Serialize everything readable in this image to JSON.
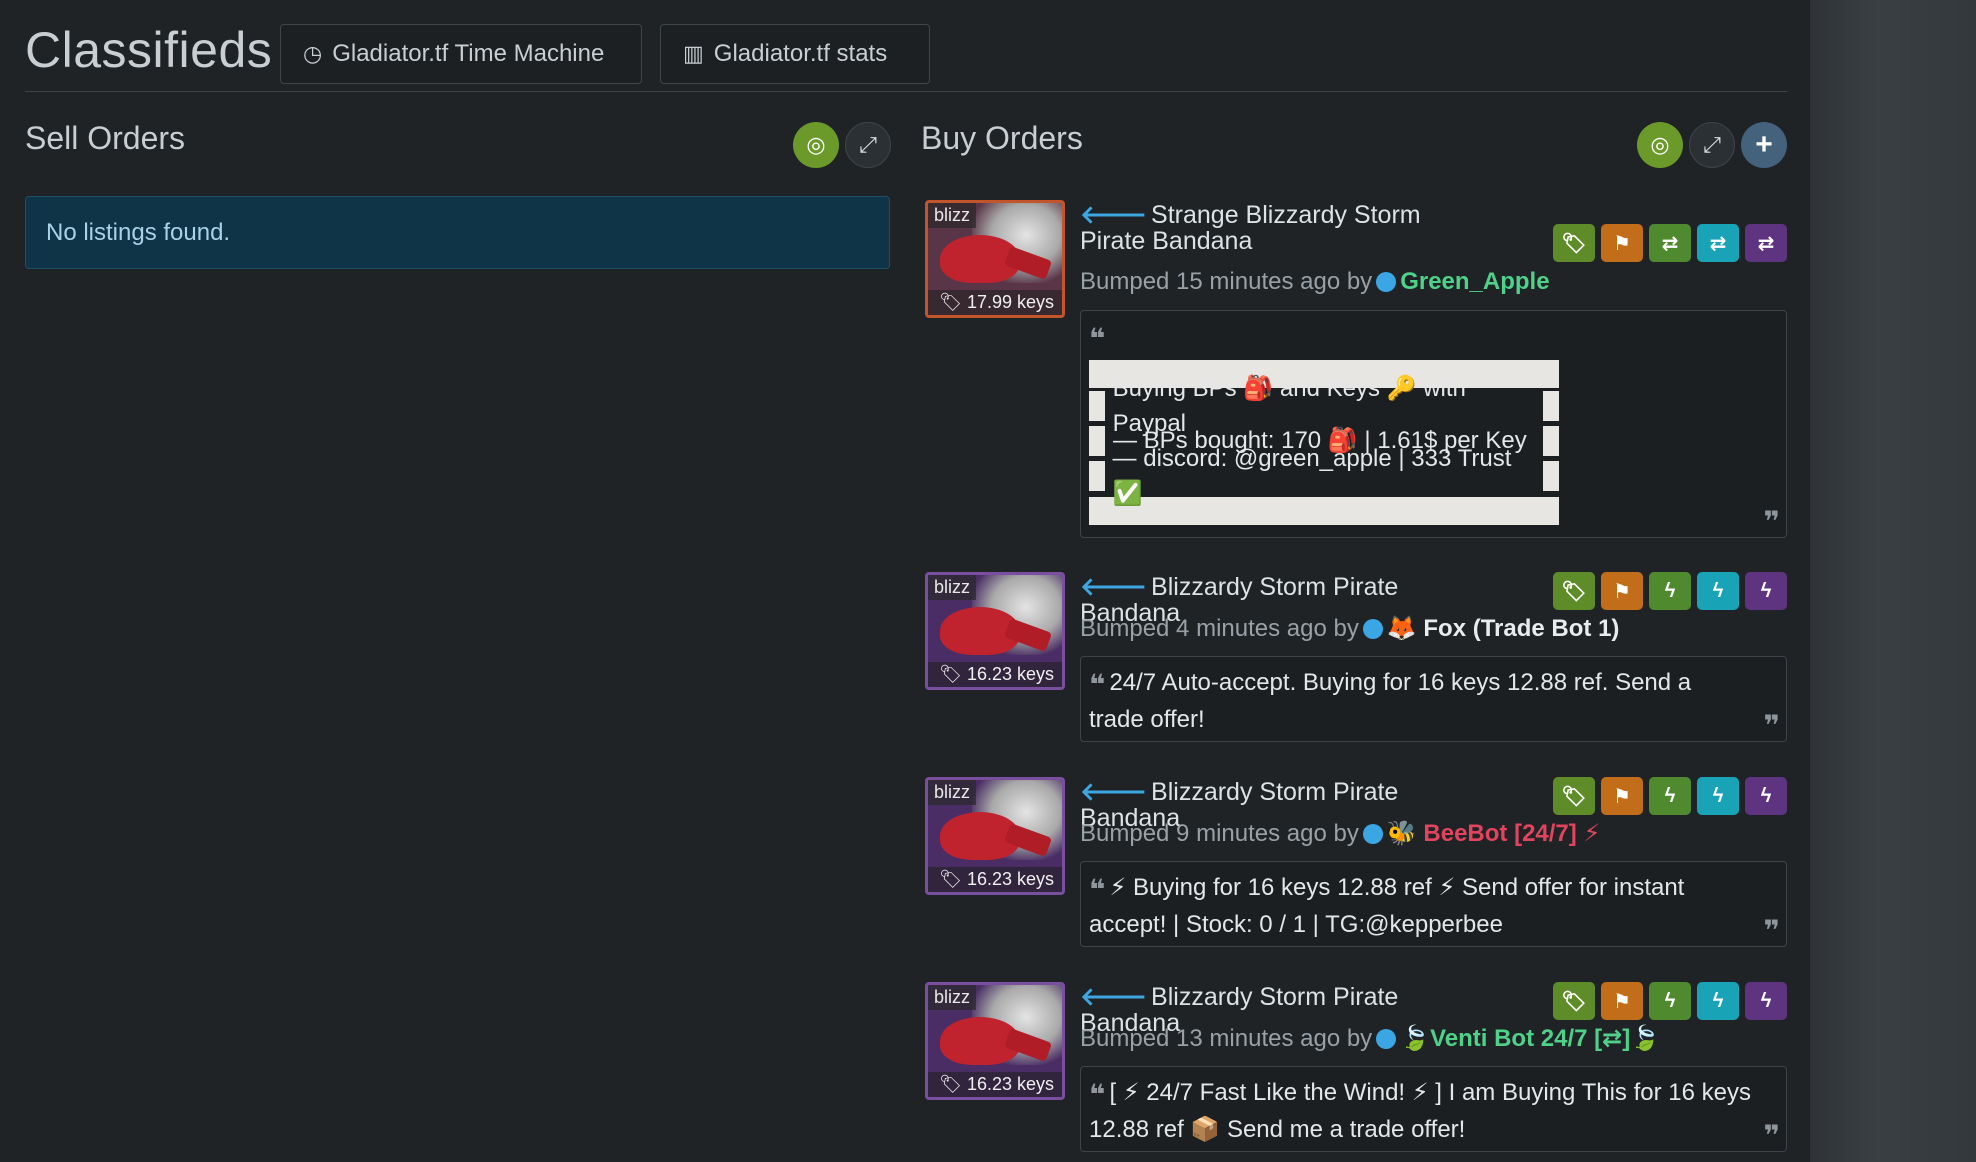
{
  "header": {
    "title": "Classifieds",
    "time_machine": "Gladiator.tf Time Machine",
    "stats": "Gladiator.tf stats"
  },
  "sell": {
    "title": "Sell Orders",
    "empty": "No listings found."
  },
  "buy": {
    "title": "Buy Orders"
  },
  "listings": [
    {
      "thumb_label": "blizz",
      "price": "17.99 keys",
      "name": "Strange Blizzardy Storm Pirate Bandana",
      "bumped": "Bumped 15 minutes ago by",
      "user": "Green_Apple",
      "user_color": "#4fd18a",
      "quote_lines": [
        "Buying BPs 🎒 and Keys 🔑 with Paypal",
        "— BPs bought: 170 🎒 | 1.61$ per Key",
        "— discord: @green_apple | 333 Trust ✅"
      ]
    },
    {
      "thumb_label": "blizz",
      "price": "16.23 keys",
      "name": "Blizzardy Storm Pirate Bandana",
      "bumped": "Bumped 4 minutes ago by",
      "user": "🦊 Fox (Trade Bot 1)",
      "user_color": "#e9ecee",
      "quote": "24/7 Auto-accept. Buying for 16 keys 12.88 ref. Send a trade offer!"
    },
    {
      "thumb_label": "blizz",
      "price": "16.23 keys",
      "name": "Blizzardy Storm Pirate Bandana",
      "bumped": "Bumped 9 minutes ago by",
      "user": "🐝 BeeBot [24/7] ⚡",
      "user_color": "#e2445e",
      "quote": "⚡ Buying for 16 keys 12.88 ref ⚡ Send offer for instant accept! | Stock: 0 / 1 | TG:@kepperbee"
    },
    {
      "thumb_label": "blizz",
      "price": "16.23 keys",
      "name": "Blizzardy Storm Pirate Bandana",
      "bumped": "Bumped 13 minutes ago by",
      "user": "🍃Venti Bot 24/7 [⇄]🍃",
      "user_color": "#4fd18a",
      "quote": "[ ⚡ 24/7 Fast Like the Wind! ⚡ ] I am Buying This for 16 keys 12.88 ref 📦 Send me a trade offer!"
    }
  ],
  "icons": {
    "hide": "eye-slash-icon",
    "expand": "expand-icon",
    "add": "plus-icon",
    "tag": "tag-icon",
    "flag": "flag-icon",
    "trade": "exchange-icon",
    "bolt": "bolt-icon",
    "arrow": "arrow-left-icon"
  }
}
